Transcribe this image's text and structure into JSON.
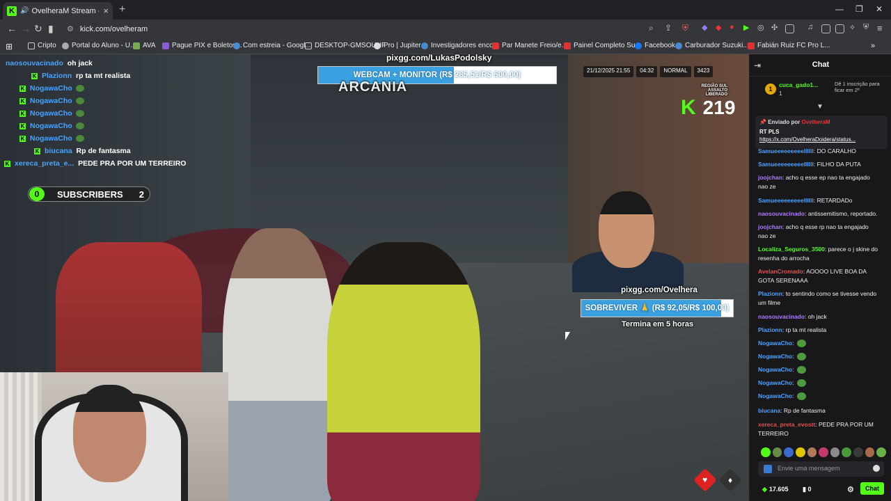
{
  "browser": {
    "tab_title": "OvelheraM Stream - Watch L",
    "tab_favicon": "K",
    "url": "kick.com/ovelheram",
    "bookmarks": [
      "Cripto",
      "Portal do Aluno - U...",
      "AVA",
      "Pague PIX e Boletos...",
      "Com estreia - Googl...",
      "DESKTOP-GMSOUHF",
      "Pro | Jupiter",
      "Investigadores enco...",
      "Par Manete Freio/e...",
      "Painel Completo Su...",
      "Facebook",
      "Carburador Suzuki...",
      "Fabián Ruiz FC Pro L..."
    ]
  },
  "stream": {
    "overlay_chat": [
      {
        "user": "naosouvacinado",
        "msg": "oh jack",
        "color": "#4aa3ff",
        "badge": false
      },
      {
        "user": "Plazionn",
        "msg": "rp ta mt realista",
        "color": "#4aa3ff",
        "badge": true
      },
      {
        "user": "NogawaCho",
        "msg": "",
        "color": "#4aa3ff",
        "badge": true
      },
      {
        "user": "NogawaCho",
        "msg": "",
        "color": "#4aa3ff",
        "badge": true
      },
      {
        "user": "NogawaCho",
        "msg": "",
        "color": "#4aa3ff",
        "badge": true
      },
      {
        "user": "NogawaCho",
        "msg": "",
        "color": "#4aa3ff",
        "badge": true
      },
      {
        "user": "NogawaCho",
        "msg": "",
        "color": "#4aa3ff",
        "badge": true
      },
      {
        "user": "biucana",
        "msg": "Rp de fantasma",
        "color": "#4aa3ff",
        "badge": true
      },
      {
        "user": "xereca_preta_e...",
        "msg": "PEDE PRA POR UM TERREIRO",
        "color": "#4aa3ff",
        "badge": true
      }
    ],
    "subscribers": {
      "left": "0",
      "label": "SUBSCRIBERS",
      "right": "2"
    },
    "top_pix": "pixgg.com/LukasPodolsky",
    "goal1": {
      "text": "WEBCAM + MONITOR (R$ 285,51/R$ 500,00)",
      "progress": 0.571
    },
    "goal2_pix": "pixgg.com/Ovelhera",
    "goal2": {
      "text": "SOBREVIVER 🙏 (R$ 92,05/R$ 100,00)",
      "progress": 0.92
    },
    "goal2_sub": "Termina em 5 horas",
    "game_logo": "ARCANIA",
    "hud": {
      "date": "21/12/2025 21:55",
      "time": "04:32",
      "mode": "NORMAL",
      "id": "3423"
    },
    "region": "REGIÃO SUL ASSALTO LIBERADO",
    "viewers": "219"
  },
  "chat": {
    "title": "Chat",
    "gift_user": "cuca_gado1...",
    "gift_count": "1",
    "gift_info": "Dê 1 inscrição para ficar em 2º",
    "pinned_by_label": "Enviado por",
    "pinned_by_user": "OvelheraM",
    "pinned_msg": "RT PLS",
    "pinned_link": "https://x.com/OvelheraDoidera/status...",
    "messages": [
      {
        "user": "Samueeeeeeeeellllll",
        "msg": "DO CARALHO",
        "color": "#4aa3ff"
      },
      {
        "user": "Samueeeeeeeeellllll",
        "msg": "FILHO DA PUTA",
        "color": "#4aa3ff"
      },
      {
        "user": "joojchan",
        "msg": "acho q esse ep nao ta engajado nao ze",
        "color": "#b07aff"
      },
      {
        "user": "Samueeeeeeeeellllll",
        "msg": "RETARDADo",
        "color": "#4aa3ff"
      },
      {
        "user": "naosouvacinado",
        "msg": "antissemitismo, reportado.",
        "color": "#b07aff"
      },
      {
        "user": "joojchan",
        "msg": "acho q esse rp nao ta engajado nao ze",
        "color": "#b07aff"
      },
      {
        "user": "Localiza_Seguros_3500",
        "msg": "parece o j skine do resenha do arrocha",
        "color": "#53fc18"
      },
      {
        "user": "AvelanCromado",
        "msg": "AOOOO LIVE BOA DA GOTA SERENAAA",
        "color": "#e05050"
      },
      {
        "user": "Plazionn",
        "msg": "to sentindo como se tivesse vendo um filme",
        "color": "#4aa3ff"
      },
      {
        "user": "naosouvacinado",
        "msg": "oh jack",
        "color": "#b07aff"
      },
      {
        "user": "Plazionn",
        "msg": "rp ta mt realista",
        "color": "#4aa3ff"
      },
      {
        "user": "NogawaCho",
        "msg": "",
        "color": "#4aa3ff"
      },
      {
        "user": "NogawaCho",
        "msg": "",
        "color": "#4aa3ff"
      },
      {
        "user": "NogawaCho",
        "msg": "",
        "color": "#4aa3ff"
      },
      {
        "user": "NogawaCho",
        "msg": "",
        "color": "#4aa3ff"
      },
      {
        "user": "NogawaCho",
        "msg": "",
        "color": "#4aa3ff"
      },
      {
        "user": "biucana",
        "msg": "Rp de fantasma",
        "color": "#4aa3ff"
      },
      {
        "user": "xereca_preta_evostt",
        "msg": "PEDE PRA POR UM TERREIRO",
        "color": "#e05050"
      }
    ],
    "input_placeholder": "Envie uma mensagem",
    "points": "17.605",
    "bag_count": "0",
    "send_label": "Chat"
  },
  "colors": {
    "kick_green": "#53fc18",
    "goal_blue": "#3aa0e0"
  }
}
